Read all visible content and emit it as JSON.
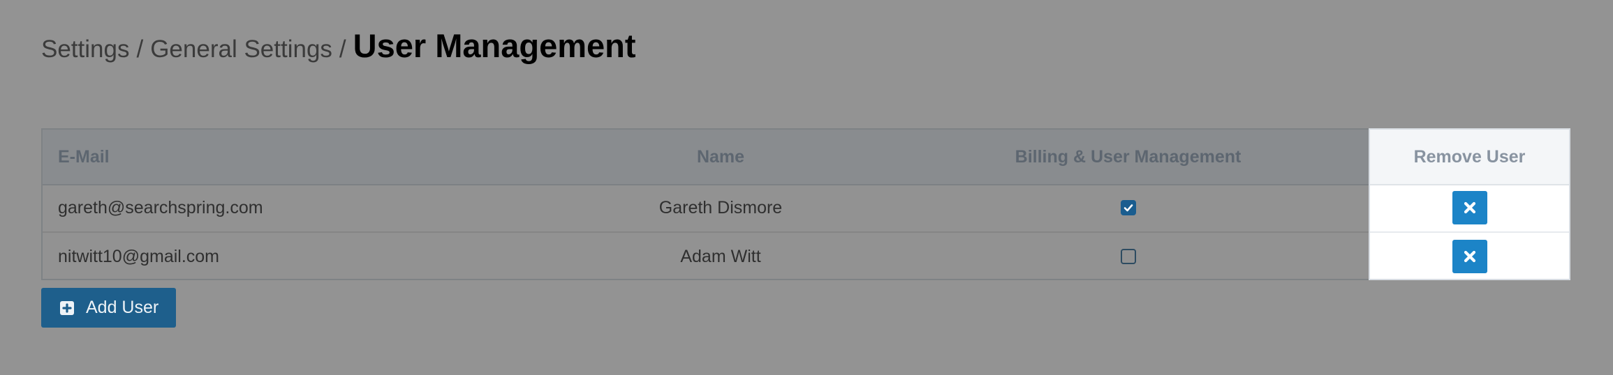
{
  "breadcrumb": {
    "items": [
      "Settings",
      "General Settings"
    ],
    "separator": "/",
    "current": "User Management"
  },
  "table": {
    "columns": [
      "E-Mail",
      "Name",
      "Billing & User Management",
      "Remove User"
    ],
    "rows": [
      {
        "email": "gareth@searchspring.com",
        "name": "Gareth Dismore",
        "billing": true
      },
      {
        "email": "nitwitt10@gmail.com",
        "name": "Adam Witt",
        "billing": false
      }
    ]
  },
  "actions": {
    "add_user_label": "Add User"
  },
  "icons": {
    "remove": "close-icon",
    "add": "plus-square-icon",
    "checked": "check-icon"
  },
  "colors": {
    "accent": "#1c84c7",
    "add_button": "#1e5f8c",
    "overlay_bg": "#939393"
  }
}
